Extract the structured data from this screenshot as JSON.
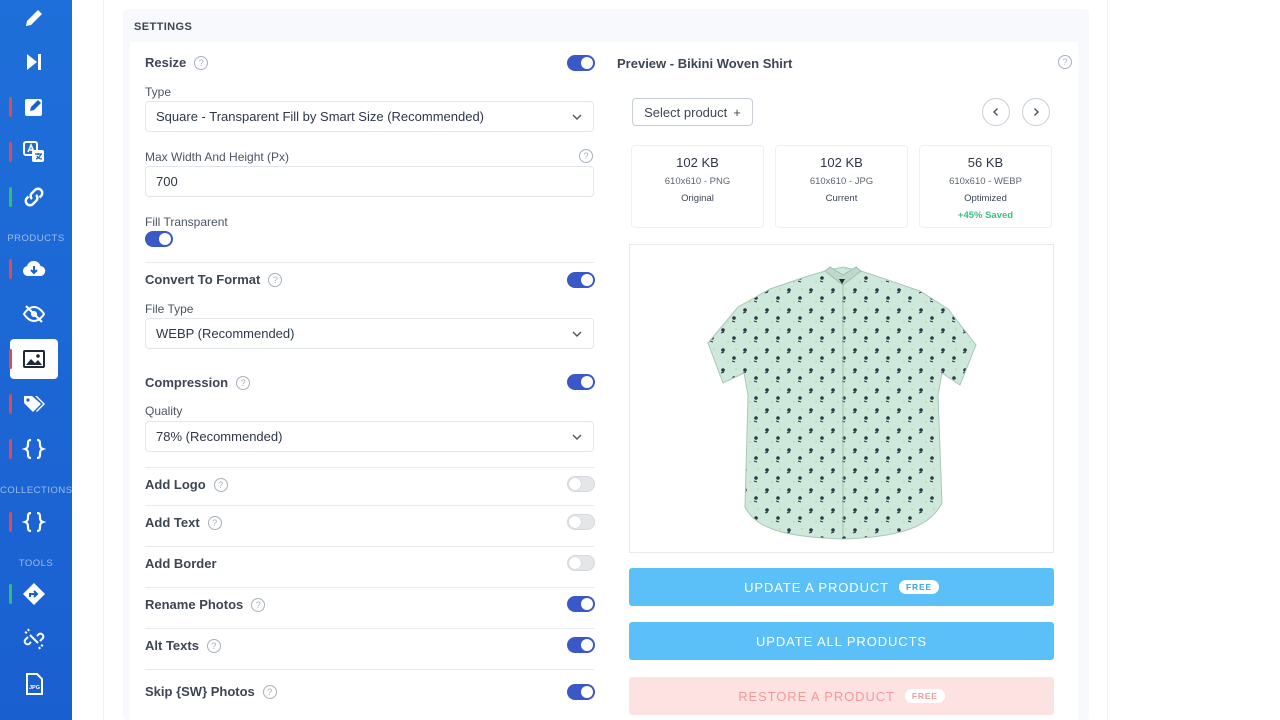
{
  "sidebar": {
    "sections": [
      "PRODUCTS",
      "COLLECTIONS",
      "TOOLS"
    ],
    "items": [
      {
        "icon": "pencil-icon",
        "marker": ""
      },
      {
        "icon": "skip-forward-icon",
        "marker": ""
      },
      {
        "icon": "edit-square-icon",
        "marker": "#e5484d"
      },
      {
        "icon": "translate-icon",
        "marker": "#e5484d"
      },
      {
        "icon": "link-icon",
        "marker": "#2fbf71"
      },
      {
        "icon": "cloud-download-icon",
        "marker": "#e5484d"
      },
      {
        "icon": "eye-off-icon",
        "marker": ""
      },
      {
        "icon": "image-icon",
        "marker": "#e5484d"
      },
      {
        "icon": "tags-icon",
        "marker": "#e5484d"
      },
      {
        "icon": "code-braces-icon",
        "marker": "#e5484d"
      },
      {
        "icon": "code-braces-icon",
        "marker": "#e5484d"
      },
      {
        "icon": "redirect-icon",
        "marker": "#2fbf71"
      },
      {
        "icon": "broken-link-icon",
        "marker": ""
      },
      {
        "icon": "jpg-file-icon",
        "marker": ""
      }
    ],
    "jpg_label": "JPG"
  },
  "settings": {
    "title": "SETTINGS",
    "resize": {
      "label": "Resize",
      "enabled": true,
      "type_label": "Type",
      "type_value": "Square - Transparent Fill by Smart Size (Recommended)",
      "max_label": "Max Width And Height (Px)",
      "max_value": "700",
      "fill_label": "Fill Transparent",
      "fill_enabled": true
    },
    "convert": {
      "label": "Convert To Format",
      "enabled": true,
      "file_type_label": "File Type",
      "file_type_value": "WEBP (Recommended)"
    },
    "compression": {
      "label": "Compression",
      "enabled": true,
      "quality_label": "Quality",
      "quality_value": "78% (Recommended)"
    },
    "add_logo": {
      "label": "Add Logo",
      "enabled": false
    },
    "add_text": {
      "label": "Add Text",
      "enabled": false
    },
    "add_border": {
      "label": "Add Border",
      "enabled": false
    },
    "rename_photos": {
      "label": "Rename Photos",
      "enabled": true
    },
    "alt_texts": {
      "label": "Alt Texts",
      "enabled": true
    },
    "skip_sw": {
      "label": "Skip {SW} Photos",
      "enabled": true
    }
  },
  "preview": {
    "title": "Preview - Bikini Woven Shirt",
    "select_product": "Select product",
    "select_plus": "+",
    "stats": [
      {
        "size": "102 KB",
        "dim": "610x610 - PNG",
        "kind": "Original",
        "saved": ""
      },
      {
        "size": "102 KB",
        "dim": "610x610 - JPG",
        "kind": "Current",
        "saved": ""
      },
      {
        "size": "56 KB",
        "dim": "610x610 - WEBP",
        "kind": "Optimized",
        "saved": "+45% Saved"
      }
    ]
  },
  "actions": {
    "update_one": "UPDATE A PRODUCT",
    "update_all": "UPDATE ALL PRODUCTS",
    "restore": "RESTORE A PRODUCT",
    "free_badge": "FREE"
  },
  "colors": {
    "sidebar": "#1a5fd0",
    "toggle_on": "#3b58c9",
    "primary_button": "#5bc0f8",
    "restore_button": "#fde2e2",
    "saved_green": "#3fbf7f"
  }
}
